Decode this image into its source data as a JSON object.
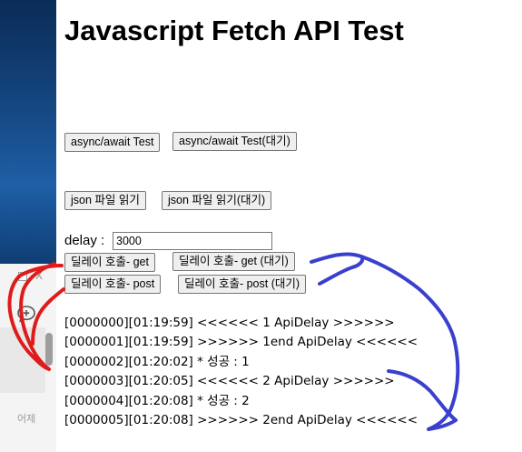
{
  "page": {
    "title": "Javascript Fetch API Test"
  },
  "buttons": {
    "async_test": "async/await Test",
    "async_test_wait": "async/await Test(대기)",
    "json_read": "json 파일 읽기",
    "json_read_wait": "json 파일 읽기(대기)",
    "delay_get": "딜레이 호출- get",
    "delay_get_wait": "딜레이 호출- get (대기)",
    "delay_post": "딜레이 호출- post",
    "delay_post_wait": "딜레이 호출- post (대기)"
  },
  "delay": {
    "label": "delay :",
    "value": "3000"
  },
  "log": [
    "[0000000][01:19:59] <<<<<< 1 ApiDelay >>>>>>",
    "[0000001][01:19:59] >>>>>> 1end ApiDelay <<<<<<",
    "[0000002][01:20:02] * 성공 : 1",
    "[0000003][01:20:05] <<<<<< 2 ApiDelay >>>>>>",
    "[0000004][01:20:08] * 성공 : 2",
    "[0000005][01:20:08] >>>>>> 2end ApiDelay <<<<<<"
  ],
  "sidebar": {
    "close_glyph": "X",
    "bottom_label": "어제",
    "chat_icon": "chat-add-icon"
  },
  "annotation_colors": {
    "red": "#e01b1b",
    "blue": "#3a3fcf"
  },
  "colors": {
    "desktop_blue": "#164a86",
    "button_bg": "#efefef",
    "button_border": "#767676"
  }
}
